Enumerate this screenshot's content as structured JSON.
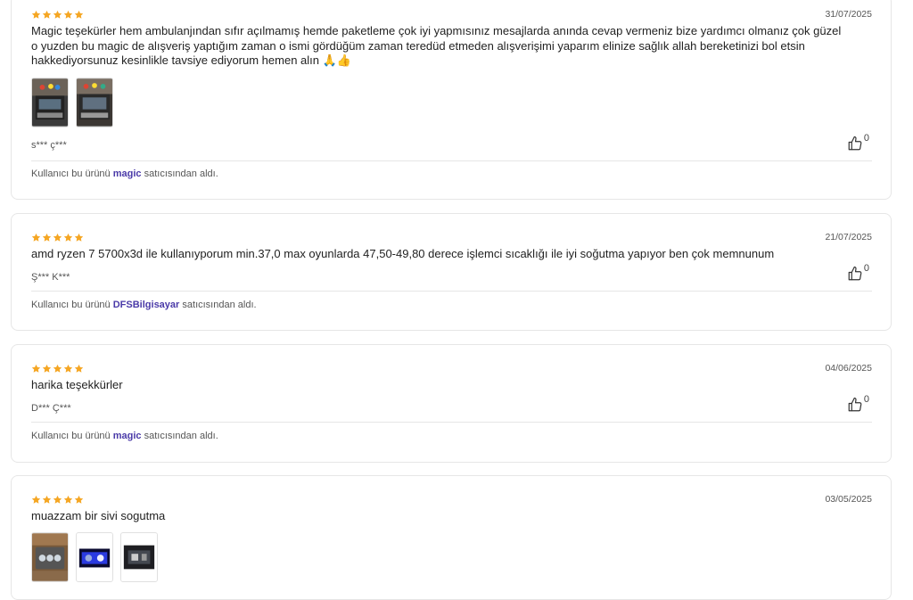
{
  "colors": {
    "star": "#f5a623",
    "seller_link": "#4a3aa8",
    "border": "#e6e6e6"
  },
  "icons": {
    "rating": "star-icon",
    "like": "thumbs-up-icon"
  },
  "reviews": [
    {
      "rating": 5,
      "date": "31/07/2025",
      "text": "Magic teşekürler hem ambulanjından sıfır açılmamış hemde paketleme çok iyi yapmısınız mesajlarda anında cevap vermeniz bize yardımcı olmanız çok güzel o yuzden bu magic de alışveriş yaptığım zaman o ismi gördüğüm zaman teredüd etmeden alışverişimi yaparım elinize sağlık allah bereketinizi bol etsin hakkediyorsunuz kesinlikle tavsiye ediyorum hemen alın 🙏👍",
      "photos": [
        "photo-1",
        "photo-2"
      ],
      "user": "s*** ç***",
      "likes": "0",
      "seller_prefix": "Kullanıcı bu ürünü",
      "seller": "magic",
      "seller_suffix": "satıcısından aldı."
    },
    {
      "rating": 5,
      "date": "21/07/2025",
      "text": "amd ryzen 7 5700x3d ile kullanıyporum min.37,0 max oyunlarda 47,50-49,80 derece işlemci sıcaklığı ile iyi soğutma yapıyor ben çok memnunum",
      "user": "Ş*** K***",
      "likes": "0",
      "seller_prefix": "Kullanıcı bu ürünü",
      "seller": "DFSBilgisayar",
      "seller_suffix": "satıcısından aldı."
    },
    {
      "rating": 5,
      "date": "04/06/2025",
      "text": "harika teşekkürler",
      "user": "D*** Ç***",
      "likes": "0",
      "seller_prefix": "Kullanıcı bu ürünü",
      "seller": "magic",
      "seller_suffix": "satıcısından aldı."
    },
    {
      "rating": 5,
      "date": "03/05/2025",
      "text": "muazzam bir sivi sogutma",
      "photos": [
        "photo-1",
        "photo-2",
        "photo-3"
      ]
    }
  ]
}
